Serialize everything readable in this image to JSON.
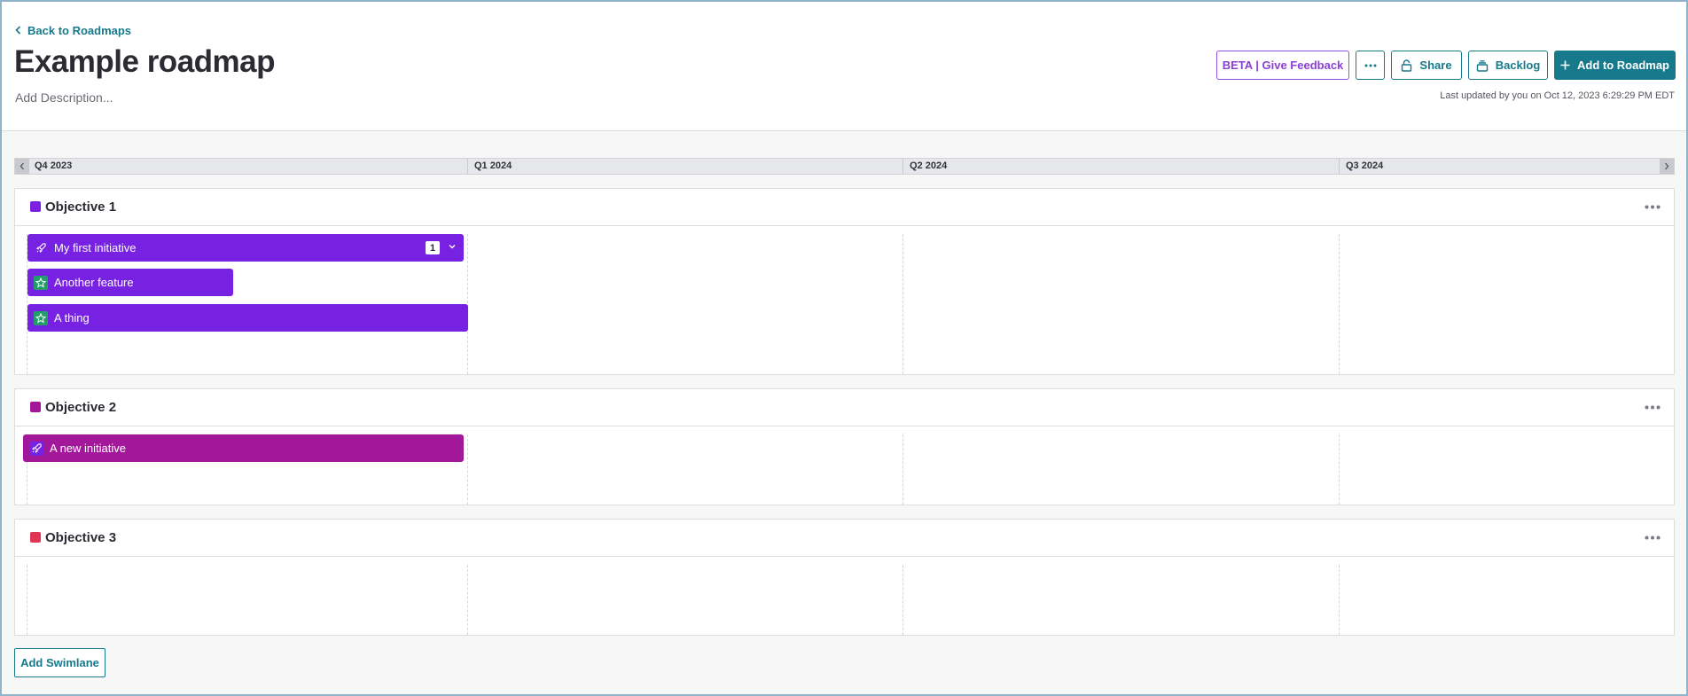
{
  "header": {
    "back_label": "Back to Roadmaps",
    "title": "Example roadmap",
    "description_placeholder": "Add Description...",
    "last_updated": "Last updated by you on Oct 12, 2023 6:29:29 PM EDT"
  },
  "actions": {
    "feedback_label": "BETA | Give Feedback",
    "share_label": "Share",
    "backlog_label": "Backlog",
    "add_label": "Add to Roadmap"
  },
  "timeline": {
    "quarters": [
      "Q4 2023",
      "Q1 2024",
      "Q2 2024",
      "Q3 2024"
    ]
  },
  "lanes": [
    {
      "title": "Objective 1",
      "color": "#7a22e0",
      "items": [
        {
          "label": "My first initiative",
          "type": "initiative",
          "color": "#7722e2",
          "count": "1"
        },
        {
          "label": "Another feature",
          "type": "feature",
          "color": "#7722e2"
        },
        {
          "label": "A thing",
          "type": "feature",
          "color": "#7722e2"
        }
      ]
    },
    {
      "title": "Objective 2",
      "color": "#a3189a",
      "items": [
        {
          "label": "A new initiative",
          "type": "initiative",
          "color": "#a3189a"
        }
      ]
    },
    {
      "title": "Objective 3",
      "color": "#e03455",
      "items": []
    }
  ],
  "footer": {
    "add_swimlane_label": "Add Swimlane"
  },
  "colors": {
    "accent": "#167a8c",
    "feedback": "#8b3fd9",
    "feature_icon_bg": "#1f9e6a"
  }
}
